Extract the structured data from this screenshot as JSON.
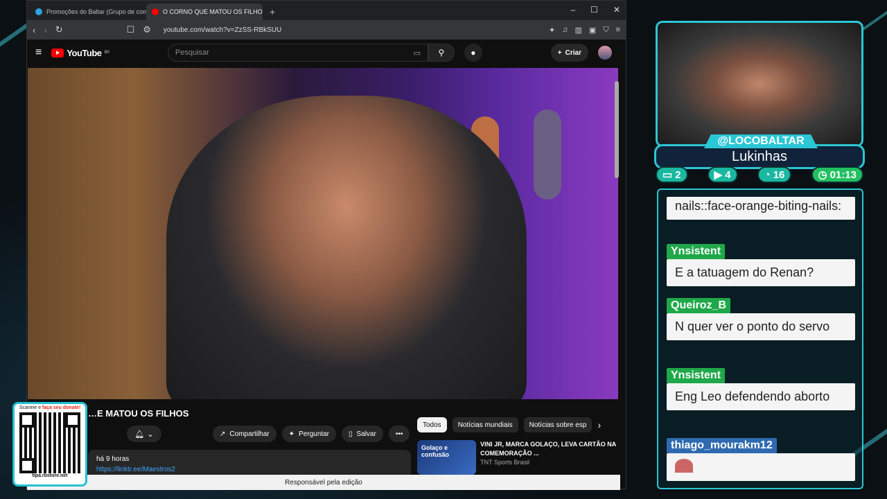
{
  "browser": {
    "tabs": [
      {
        "title": "Promoções do Baltar (Grupo de comentários)",
        "active": false
      },
      {
        "title": "O CORNO QUE MATOU OS FILHOS - YouTube",
        "active": true
      }
    ],
    "new_tab": "+",
    "url": "youtube.com/watch?v=ZzSS-RBkSUU",
    "window_controls": {
      "minimize": "–",
      "maximize": "☐",
      "close": "✕"
    }
  },
  "youtube": {
    "logo": "YouTube",
    "region": "BR",
    "search_placeholder": "Pesquisar",
    "create_label": "Criar",
    "video_title": "…E MATOU OS FILHOS",
    "buttons": {
      "share": "Compartilhar",
      "ask": "Perguntar",
      "save": "Salvar",
      "more": "•••"
    },
    "description": {
      "time": "há 9 horas",
      "link": "https://linktr.ee/Maestros2"
    },
    "chips": [
      "Todos",
      "Notícias mundiais",
      "Notícias sobre esp"
    ],
    "recommendation": {
      "thumb_text": "Golaço e confusão",
      "title": "VINI JR, MARCA GOLAÇO, LEVA CARTÃO NA COMEMORAÇÃO ...",
      "channel": "TNT Sports Brasil"
    },
    "infobar": "Responsável pela edição"
  },
  "qr": {
    "top_text": "Scaneie e ",
    "top_highlight": "faça seu donate!",
    "bottom_text": "tipa.rbstore.net"
  },
  "streamer": {
    "handle": "@LOCOBALTAR",
    "name": "Lukinhas",
    "stats": {
      "twitch": "2",
      "youtube": "4",
      "chat": "16",
      "time": "01:13"
    }
  },
  "chat": [
    {
      "user": "",
      "text": "nails::face-orange-biting-nails:"
    },
    {
      "user": "Ynsistent",
      "color": "green",
      "text": "E a tatuagem do Renan?"
    },
    {
      "user": "Queiroz_B",
      "color": "green",
      "text": "N quer ver o ponto do servo"
    },
    {
      "user": "Ynsistent",
      "color": "green",
      "text": "Eng Leo defendendo aborto"
    },
    {
      "user": "thiago_mourakm12",
      "color": "blue",
      "text": ""
    }
  ]
}
